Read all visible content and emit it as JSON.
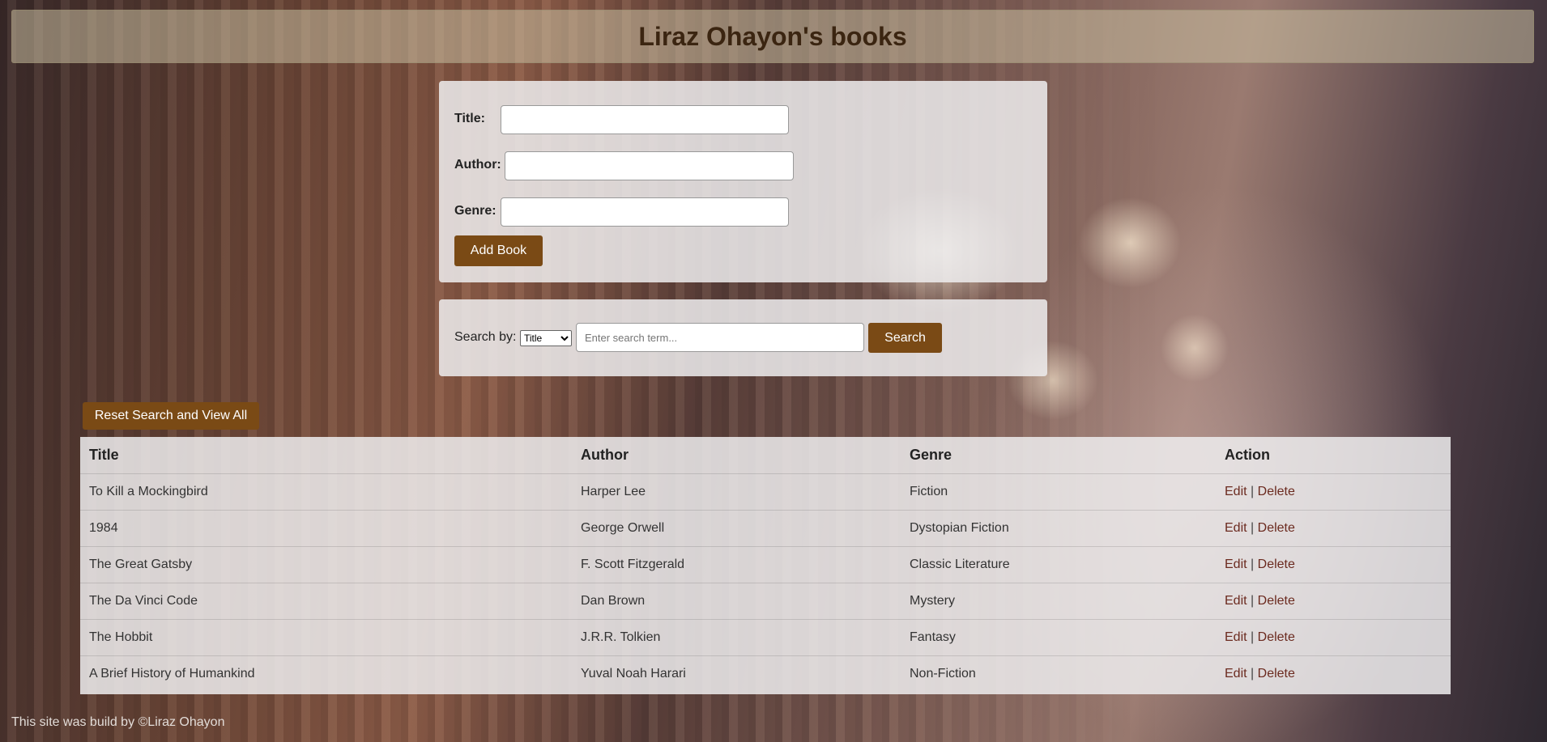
{
  "header": {
    "title": "Liraz Ohayon's books"
  },
  "add_form": {
    "title_label": "Title:",
    "author_label": "Author:",
    "genre_label": "Genre:",
    "title_value": "",
    "author_value": "",
    "genre_value": "",
    "add_button": "Add Book"
  },
  "search": {
    "label": "Search by:",
    "selected_option": "Title",
    "placeholder": "Enter search term...",
    "button": "Search"
  },
  "reset_button": "Reset Search and View All",
  "table": {
    "headers": [
      "Title",
      "Author",
      "Genre",
      "Action"
    ],
    "rows": [
      {
        "title": "To Kill a Mockingbird",
        "author": "Harper Lee",
        "genre": "Fiction"
      },
      {
        "title": "1984",
        "author": "George Orwell",
        "genre": "Dystopian Fiction"
      },
      {
        "title": "The Great Gatsby",
        "author": "F. Scott Fitzgerald",
        "genre": "Classic Literature"
      },
      {
        "title": "The Da Vinci Code",
        "author": "Dan Brown",
        "genre": "Mystery"
      },
      {
        "title": "The Hobbit",
        "author": "J.R.R. Tolkien",
        "genre": "Fantasy"
      },
      {
        "title": "A Brief History of Humankind",
        "author": "Yuval Noah Harari",
        "genre": "Non-Fiction"
      }
    ],
    "edit_label": "Edit",
    "separator": "|",
    "delete_label": "Delete"
  },
  "footer": "This site was build by ©Liraz Ohayon",
  "colors": {
    "accent": "#7a4a15",
    "title_text": "#3b2511",
    "action_link": "#6b2a1f"
  }
}
